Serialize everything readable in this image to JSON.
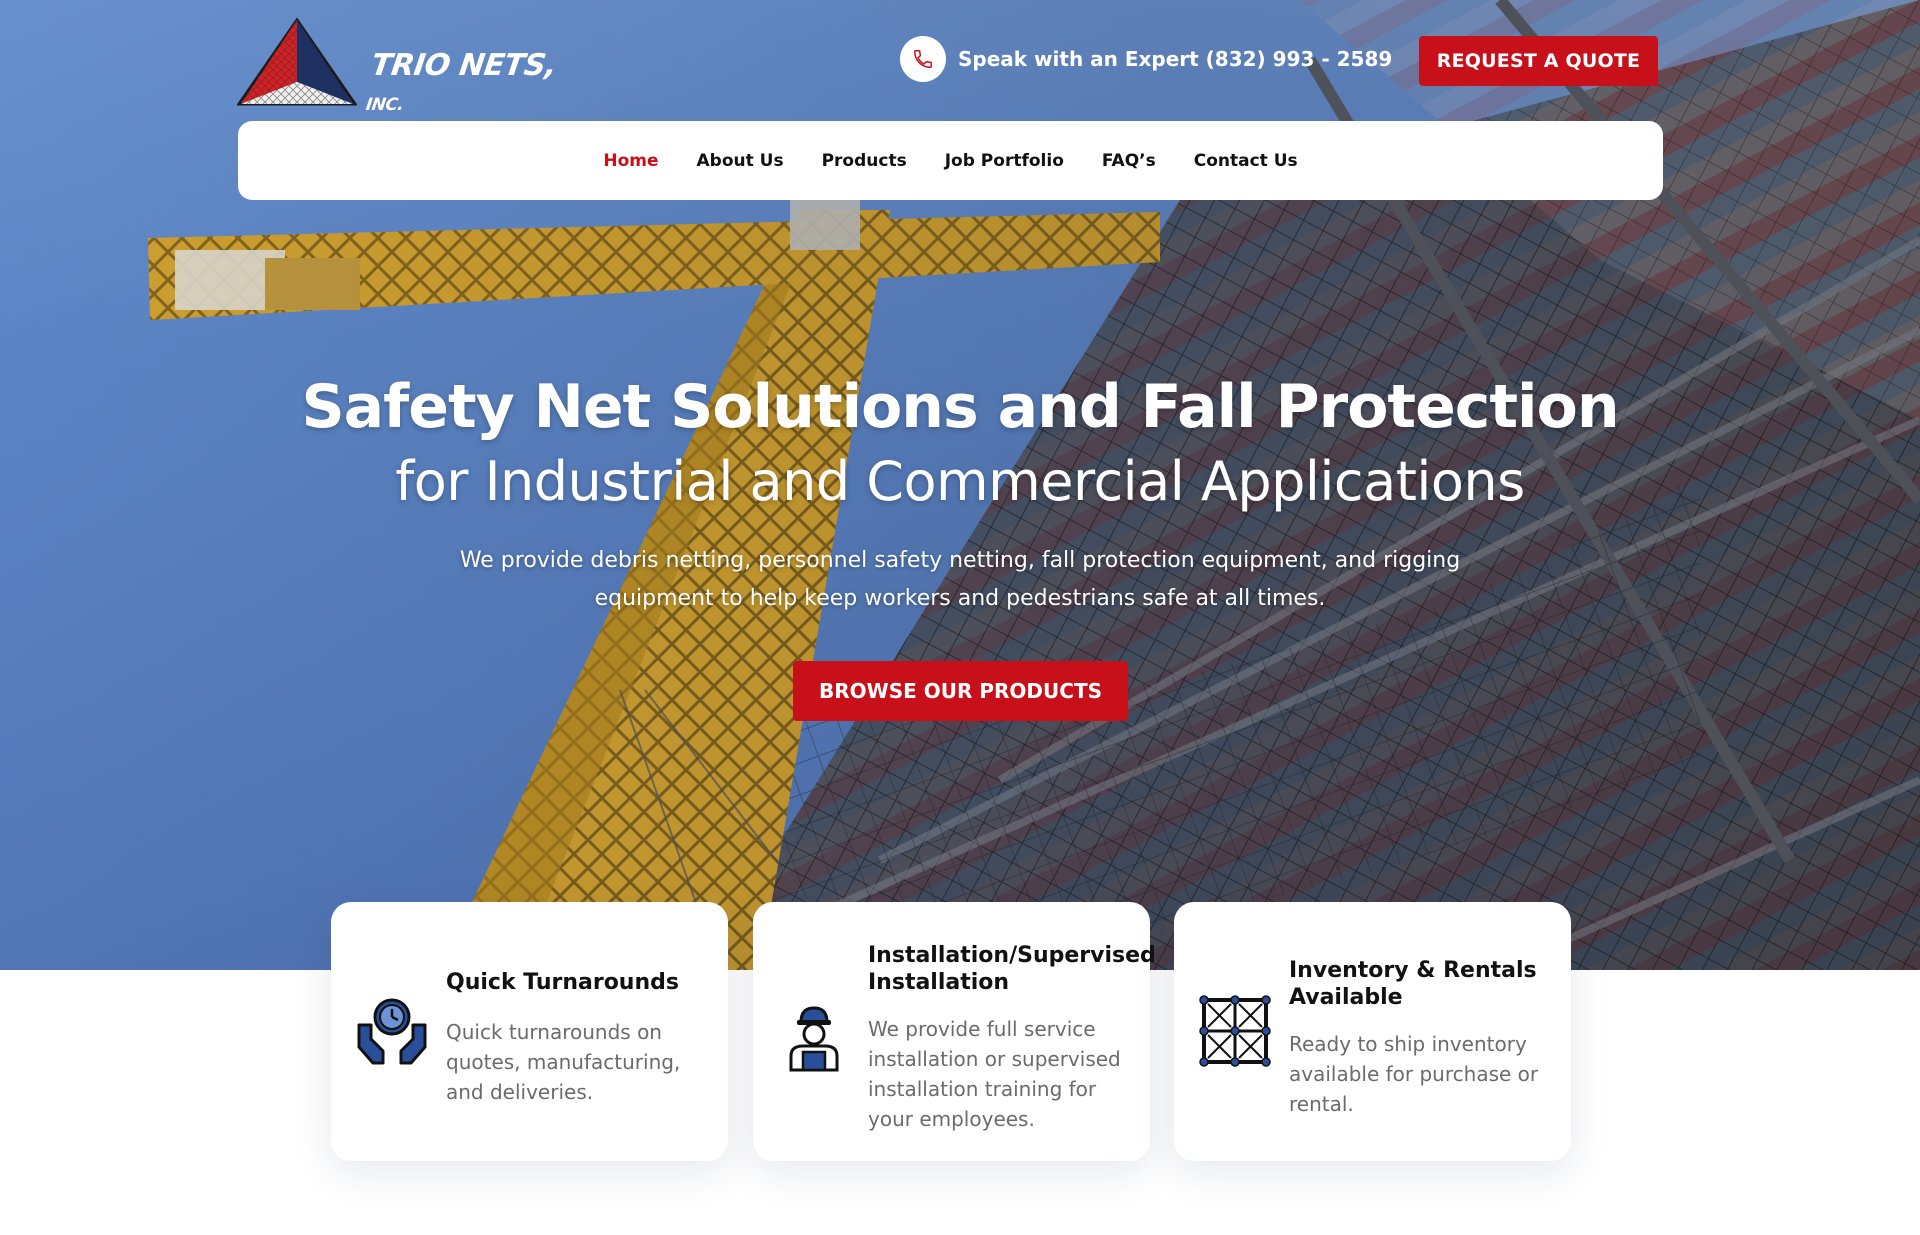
{
  "brand": {
    "name": "TRIO NETS,",
    "suffix": "INC.",
    "colors": {
      "red": "#c8101a",
      "navy": "#1b2f6b",
      "nav_active": "#c8101a"
    }
  },
  "header": {
    "phone_label": "Speak with an Expert (832) 993 - 2589",
    "phone_icon": "phone-icon",
    "quote_button": "REQUEST A QUOTE"
  },
  "nav": {
    "items": [
      {
        "label": "Home",
        "active": true
      },
      {
        "label": "About Us",
        "active": false
      },
      {
        "label": "Products",
        "active": false
      },
      {
        "label": "Job Portfolio",
        "active": false
      },
      {
        "label": "FAQ’s",
        "active": false
      },
      {
        "label": "Contact Us",
        "active": false
      }
    ]
  },
  "hero": {
    "title": "Safety Net Solutions and Fall Protection",
    "subtitle": "for Industrial and Commercial Applications",
    "description": "We provide debris netting, personnel safety netting, fall protection equipment, and rigging equipment to help keep workers and pedestrians safe at all times.",
    "cta": "BROWSE OUR PRODUCTS"
  },
  "features": [
    {
      "icon": "hands-clock-icon",
      "title": "Quick Turnarounds",
      "description": "Quick turnarounds on quotes, manufacturing, and deliveries."
    },
    {
      "icon": "worker-icon",
      "title": "Installation/Supervised Installation",
      "description": "We provide full service installation or supervised installation training for your employees."
    },
    {
      "icon": "net-grid-icon",
      "title": "Inventory & Rentals Available",
      "description": "Ready to ship inventory available for purchase or rental."
    }
  ]
}
